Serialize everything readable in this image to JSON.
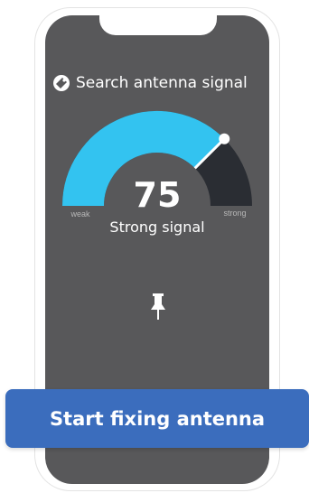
{
  "header": {
    "title": "Search antenna signal",
    "icon": "satellite-dish-icon"
  },
  "gauge": {
    "value": 75,
    "status_text": "Strong signal",
    "min_label": "weak",
    "max_label": "strong",
    "active_color": "#33c3f0",
    "inactive_color": "#2a2d33"
  },
  "pin": {
    "icon": "pushpin-icon"
  },
  "cta": {
    "label": "Start fixing antenna",
    "color": "#3b6dbd"
  }
}
